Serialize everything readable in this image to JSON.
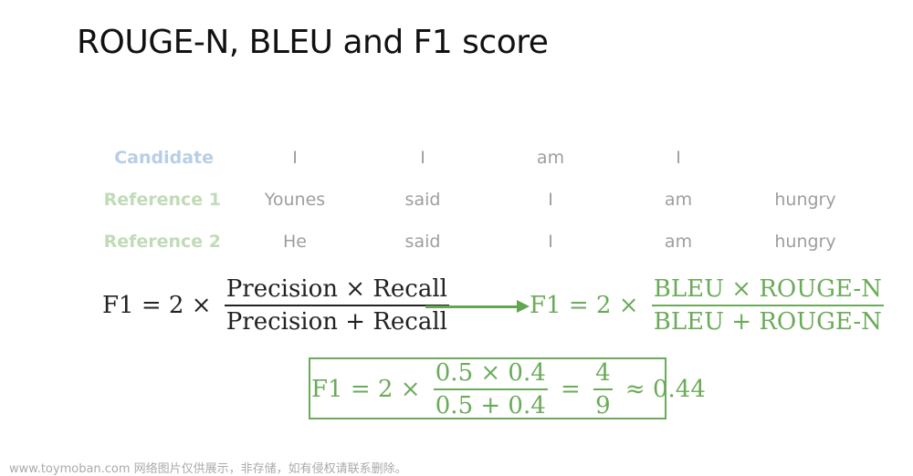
{
  "title": "ROUGE-N, BLEU and F1 score",
  "rows": [
    {
      "label": "Candidate",
      "tokens": [
        "I",
        "I",
        "am",
        "I",
        ""
      ]
    },
    {
      "label": "Reference 1",
      "tokens": [
        "Younes",
        "said",
        "I",
        "am",
        "hungry"
      ]
    },
    {
      "label": "Reference 2",
      "tokens": [
        "He",
        "said",
        "I",
        "am",
        "hungry"
      ]
    }
  ],
  "formula_general": {
    "lhs": "F1 = 2 ×",
    "numerator": "Precision × Recall",
    "denominator": "Precision + Recall"
  },
  "formula_specific": {
    "lhs": "F1 = 2 ×",
    "numerator": "BLEU × ROUGE-N",
    "denominator": "BLEU + ROUGE-N"
  },
  "formula_result": {
    "lhs": "F1 = 2 ×",
    "numerator": "0.5 × 0.4",
    "denominator": "0.5 + 0.4",
    "eq": "=",
    "frac_num": "4",
    "frac_den": "9",
    "approx": "≈ 0.44"
  },
  "colors": {
    "candidate": "#b7cfe6",
    "reference": "#bfdcb7",
    "accent_green": "#6aab59"
  },
  "watermark": "www.toymoban.com 网络图片仅供展示，非存储，如有侵权请联系删除。"
}
